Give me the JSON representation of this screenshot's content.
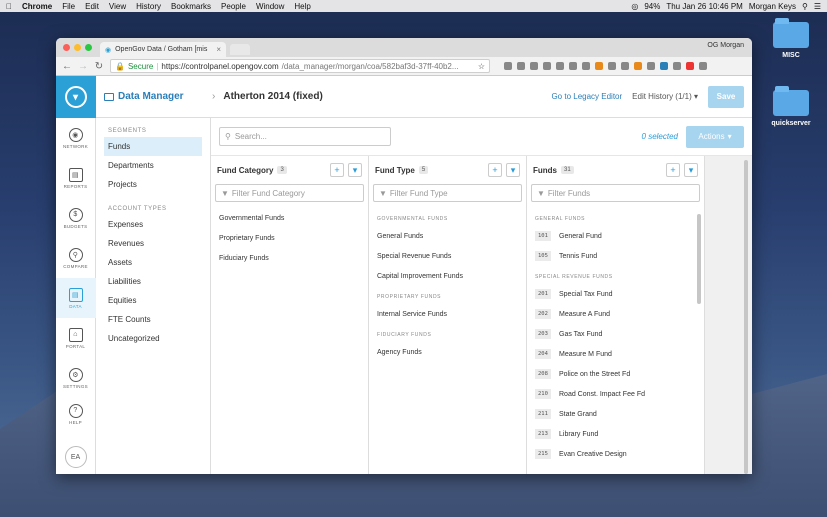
{
  "menubar": {
    "apple": "",
    "app": "Chrome",
    "items": [
      "File",
      "Edit",
      "View",
      "History",
      "Bookmarks",
      "People",
      "Window",
      "Help"
    ],
    "battery": "94%",
    "datetime": "Thu Jan 26  10:46 PM",
    "user": "Morgan Keys"
  },
  "desktop": [
    {
      "label": "MISC"
    },
    {
      "label": "quickserver"
    }
  ],
  "browser": {
    "tab_title": "OpenGov Data / Gotham [mis",
    "profile": "OG Morgan",
    "url_secure": "Secure",
    "url_host": "https://controlpanel.opengov.com",
    "url_path": "/data_manager/morgan/coa/582baf3d-37ff-40b2..."
  },
  "nav": [
    {
      "icon": "network-icon",
      "label": "NETWORK"
    },
    {
      "icon": "reports-icon",
      "label": "REPORTS"
    },
    {
      "icon": "budgets-icon",
      "label": "BUDGETS"
    },
    {
      "icon": "compare-icon",
      "label": "COMPARE"
    },
    {
      "icon": "data-icon",
      "label": "DATA"
    },
    {
      "icon": "portal-icon",
      "label": "PORTAL"
    },
    {
      "icon": "settings-icon",
      "label": "SETTINGS"
    },
    {
      "icon": "help-icon",
      "label": "HELP"
    }
  ],
  "avatar": "EA",
  "header": {
    "app": "Data Manager",
    "title": "Atherton 2014 (fixed)",
    "legacy": "Go to Legacy Editor",
    "history": "Edit History (1/1)",
    "save": "Save"
  },
  "segments": {
    "heading": "SEGMENTS",
    "items": [
      "Funds",
      "Departments",
      "Projects"
    ],
    "account_heading": "ACCOUNT TYPES",
    "account_items": [
      "Expenses",
      "Revenues",
      "Assets",
      "Liabilities",
      "Equities",
      "FTE Counts",
      "Uncategorized"
    ]
  },
  "toolbar": {
    "search_placeholder": "Search...",
    "selected": "0 selected",
    "actions": "Actions"
  },
  "columns": {
    "category": {
      "title": "Fund Category",
      "count": "3",
      "filter": "Filter Fund Category",
      "items": [
        "Governmental Funds",
        "Proprietary Funds",
        "Fiduciary Funds"
      ]
    },
    "type": {
      "title": "Fund Type",
      "count": "5",
      "filter": "Filter Fund Type",
      "groups": [
        {
          "name": "GOVERNMENTAL FUNDS",
          "items": [
            "General Funds",
            "Special Revenue Funds",
            "Capital Improvement Funds"
          ]
        },
        {
          "name": "PROPRIETARY FUNDS",
          "items": [
            "Internal Service Funds"
          ]
        },
        {
          "name": "FIDUCIARY FUNDS",
          "items": [
            "Agency Funds"
          ]
        }
      ]
    },
    "funds": {
      "title": "Funds",
      "count": "31",
      "filter": "Filter Funds",
      "groups": [
        {
          "name": "GENERAL FUNDS",
          "items": [
            {
              "code": "101",
              "name": "General Fund"
            },
            {
              "code": "105",
              "name": "Tennis Fund"
            }
          ]
        },
        {
          "name": "SPECIAL REVENUE FUNDS",
          "items": [
            {
              "code": "201",
              "name": "Special Tax Fund"
            },
            {
              "code": "202",
              "name": "Measure A Fund"
            },
            {
              "code": "203",
              "name": "Gas Tax Fund"
            },
            {
              "code": "204",
              "name": "Measure M Fund"
            },
            {
              "code": "208",
              "name": "Police on the Street Fd"
            },
            {
              "code": "210",
              "name": "Road Const. Impact Fee Fd"
            },
            {
              "code": "211",
              "name": "State Grand"
            },
            {
              "code": "213",
              "name": "Library Fund"
            },
            {
              "code": "215",
              "name": "Evan Creative Design"
            }
          ]
        }
      ]
    }
  }
}
